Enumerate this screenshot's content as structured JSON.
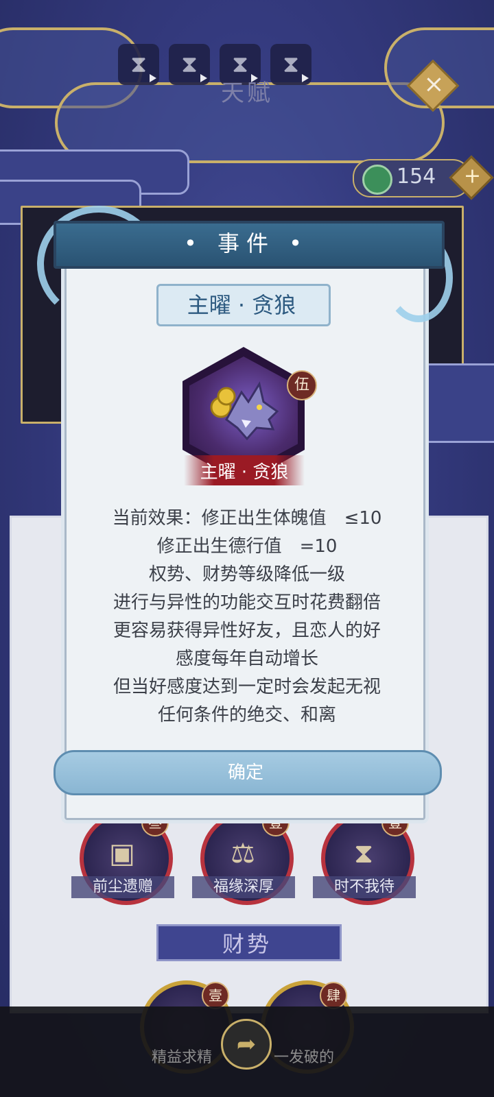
{
  "top_bar": {
    "tab_slots": [
      "⧗",
      "⧗",
      "⧗",
      "⧗"
    ],
    "title": "天赋",
    "close_icon": "×"
  },
  "currency": {
    "icon": "jade-coin-icon",
    "value": "154",
    "add_icon": "+"
  },
  "modal": {
    "title": "• 事件 •",
    "talent_name": "主曜 · 贪狼",
    "card": {
      "label": "主曜 · 贪狼",
      "level": "伍",
      "icon": "wolf-icon"
    },
    "effects": [
      "当前效果：修正出生体魄值　≤10",
      "修正出生德行值　=10",
      "权势、财势等级降低一级",
      "进行与异性的功能交互时花费翻倍",
      "更容易获得异性好友，且恋人的好",
      "感度每年自动增长",
      "但当好感度达到一定时会发起无视",
      "任何条件的绝交、和离"
    ],
    "confirm_label": "确定"
  },
  "talents_row": [
    {
      "name": "前尘遗赠",
      "level": "叁"
    },
    {
      "name": "福缘深厚",
      "level": "壹"
    },
    {
      "name": "时不我待",
      "level": "壹"
    }
  ],
  "section": {
    "title": "财势"
  },
  "bottom_talents": [
    {
      "name": "精益求精",
      "level": "壹"
    },
    {
      "name": "一发破的",
      "level": "肆"
    }
  ],
  "colors": {
    "accent": "#c9b06a",
    "modal_header": "#2a5373",
    "badge": "#6e2a24"
  }
}
